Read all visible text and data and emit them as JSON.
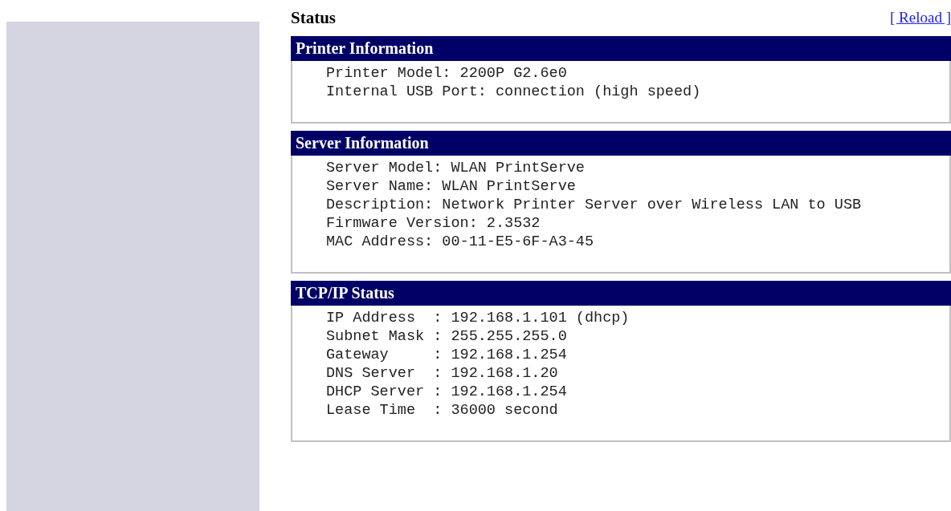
{
  "title": "Status",
  "reload_link": "[ Reload ]",
  "sections": [
    {
      "heading": "Printer Information",
      "lines": [
        "Printer Model: 2200P G2.6e0",
        "Internal USB Port: connection (high speed)"
      ]
    },
    {
      "heading": "Server Information",
      "lines": [
        "Server Model: WLAN PrintServe",
        "Server Name: WLAN PrintServe",
        "Description: Network Printer Server over Wireless LAN to USB",
        "Firmware Version: 2.3532",
        "MAC Address: 00-11-E5-6F-A3-45"
      ]
    },
    {
      "heading": "TCP/IP Status",
      "lines": [
        "IP Address  : 192.168.1.101 (dhcp)",
        "Subnet Mask : 255.255.255.0",
        "Gateway     : 192.168.1.254",
        "DNS Server  : 192.168.1.20",
        "DHCP Server : 192.168.1.254",
        "Lease Time  : 36000 second"
      ]
    }
  ]
}
